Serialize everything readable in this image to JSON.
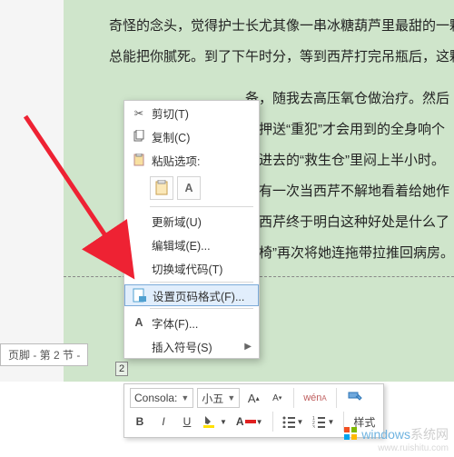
{
  "doc": {
    "lines": [
      "奇怪的念头，觉得护士长尤其像一串冰糖葫芦里最甜的一颗",
      "总能把你腻死。到了下午时分，等到西芹打完吊瓶后，这颗糖",
      "",
      "备，随我去高压氧仓做治疗。然后",
      "有押送“重犯”才会用到的全身响个",
      "钻进去的“救生仓”里闷上半小时。",
      "，有一次当西芹不解地看着给她作",
      "，西芹终于明白这种好处是什么了",
      "轮椅”再次将她连拖带拉推回病房。"
    ]
  },
  "footer": {
    "label": "页脚 - 第 2 节 -",
    "page_num": "2"
  },
  "ctx": {
    "cut": {
      "label": "剪切(T)"
    },
    "copy": {
      "label": "复制(C)"
    },
    "paste_hdr": {
      "label": "粘贴选项:"
    },
    "update": {
      "label": "更新域(U)"
    },
    "edit": {
      "label": "编辑域(E)..."
    },
    "toggle": {
      "label": "切换域代码(T)"
    },
    "pagefmt": {
      "label": "设置页码格式(F)..."
    },
    "font": {
      "label": "字体(F)..."
    },
    "symbol": {
      "label": "插入符号(S)"
    }
  },
  "mini": {
    "font_name": "Consola:",
    "font_size": "小五",
    "style_label": "样式"
  },
  "watermark": {
    "brand": "windows",
    "tail": "系统网",
    "url": "www.ruishitu.com"
  }
}
